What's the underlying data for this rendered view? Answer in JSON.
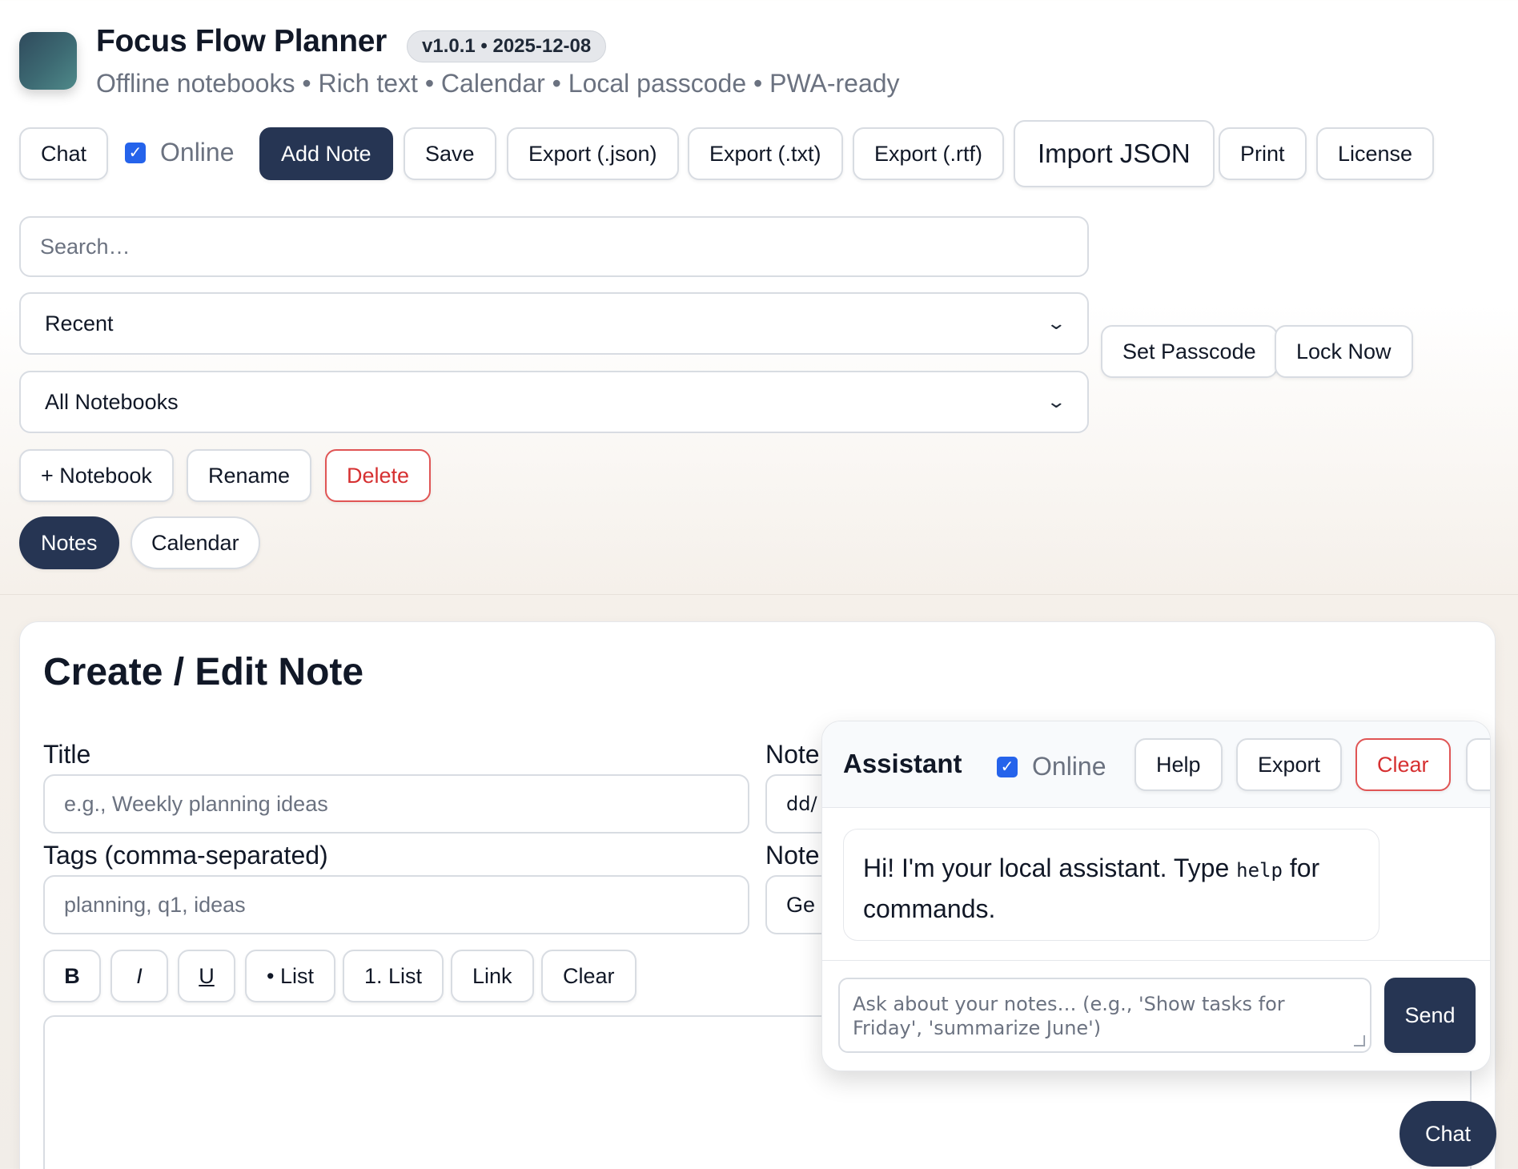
{
  "header": {
    "title": "Focus Flow Planner",
    "version": "v1.0.1 • 2025-12-08",
    "subtitle": "Offline notebooks • Rich text • Calendar • Local passcode • PWA-ready"
  },
  "toolbar": {
    "chat": "Chat",
    "online_label": "Online",
    "add_note": "Add Note",
    "save": "Save",
    "export_json": "Export (.json)",
    "export_txt": "Export (.txt)",
    "export_rtf": "Export (.rtf)",
    "import_json": "Import JSON",
    "print": "Print",
    "license": "License"
  },
  "filters": {
    "search_placeholder": "Search…",
    "sort_selected": "Recent",
    "notebook_selected": "All Notebooks"
  },
  "security": {
    "set_passcode": "Set Passcode",
    "lock_now": "Lock Now"
  },
  "notebook_actions": {
    "add": "+ Notebook",
    "rename": "Rename",
    "delete": "Delete"
  },
  "views": {
    "notes": "Notes",
    "calendar": "Calendar"
  },
  "editor": {
    "heading": "Create / Edit Note",
    "title_label": "Title",
    "title_placeholder": "e.g., Weekly planning ideas",
    "tags_label": "Tags (comma-separated)",
    "tags_placeholder": "planning, q1, ideas",
    "note_date_label": "Note",
    "note_date_value": "dd/",
    "note_notebook_label": "Note",
    "note_notebook_value": "Ge",
    "format_bold": "B",
    "format_italic": "I",
    "format_underline": "U",
    "format_bullet": "• List",
    "format_numbered": "1. List",
    "format_link": "Link",
    "format_clear": "Clear"
  },
  "assistant": {
    "title": "Assistant",
    "online_label": "Online",
    "help": "Help",
    "export": "Export",
    "clear": "Clear",
    "close": "×",
    "message_before": "Hi! I'm your local assistant. Type ",
    "message_code": "help",
    "message_after": " for commands.",
    "input_placeholder": "Ask about your notes… (e.g., 'Show tasks for Friday', 'summarize June')",
    "send": "Send"
  },
  "fab": {
    "chat": "Chat"
  },
  "colors": {
    "primary_dark": "#263553",
    "danger": "#d63031",
    "checkbox": "#2563eb"
  }
}
